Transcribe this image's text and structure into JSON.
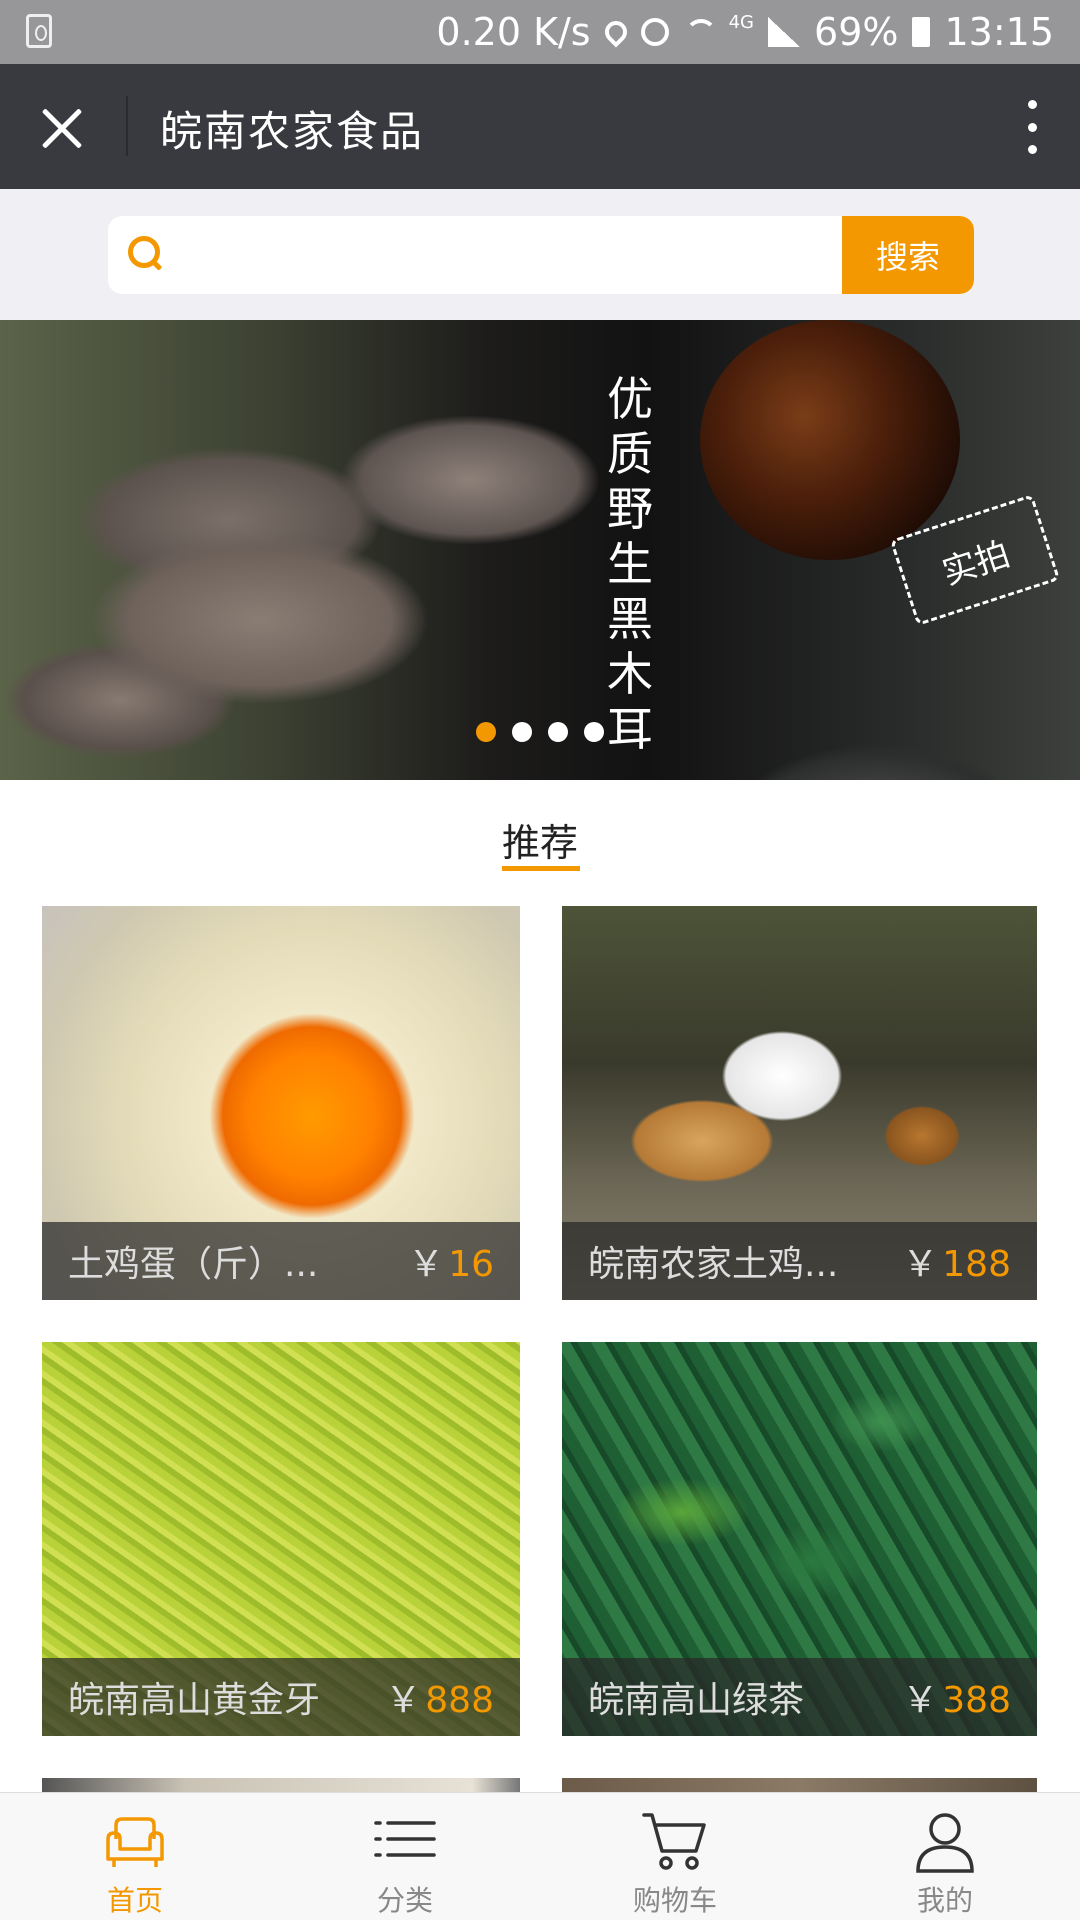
{
  "status_bar": {
    "speed": "0.20 K/s",
    "network": "4G",
    "battery": "69%",
    "time": "13:15"
  },
  "title_bar": {
    "title": "皖南农家食品"
  },
  "search": {
    "placeholder": "",
    "button_label": "搜索"
  },
  "banner": {
    "vertical_text": "优质野生黑木耳",
    "stamp_text": "实拍",
    "slide_count": 4,
    "active_slide": 1
  },
  "recommend": {
    "heading": "推荐"
  },
  "products": [
    {
      "name": "土鸡蛋（斤）...",
      "currency": "￥",
      "price": "16"
    },
    {
      "name": "皖南农家土鸡...",
      "currency": "￥",
      "price": "188"
    },
    {
      "name": "皖南高山黄金牙",
      "currency": "￥",
      "price": "888"
    },
    {
      "name": "皖南高山绿茶",
      "currency": "￥",
      "price": "388"
    }
  ],
  "tabbar": {
    "items": [
      {
        "label": "首页",
        "icon": "sofa-home-icon",
        "active": true
      },
      {
        "label": "分类",
        "icon": "list-icon",
        "active": false
      },
      {
        "label": "购物车",
        "icon": "cart-icon",
        "active": false
      },
      {
        "label": "我的",
        "icon": "user-icon",
        "active": false
      }
    ]
  },
  "colors": {
    "accent": "#f39800",
    "title_bar": "#393a3f",
    "status_bar": "#97979a"
  }
}
